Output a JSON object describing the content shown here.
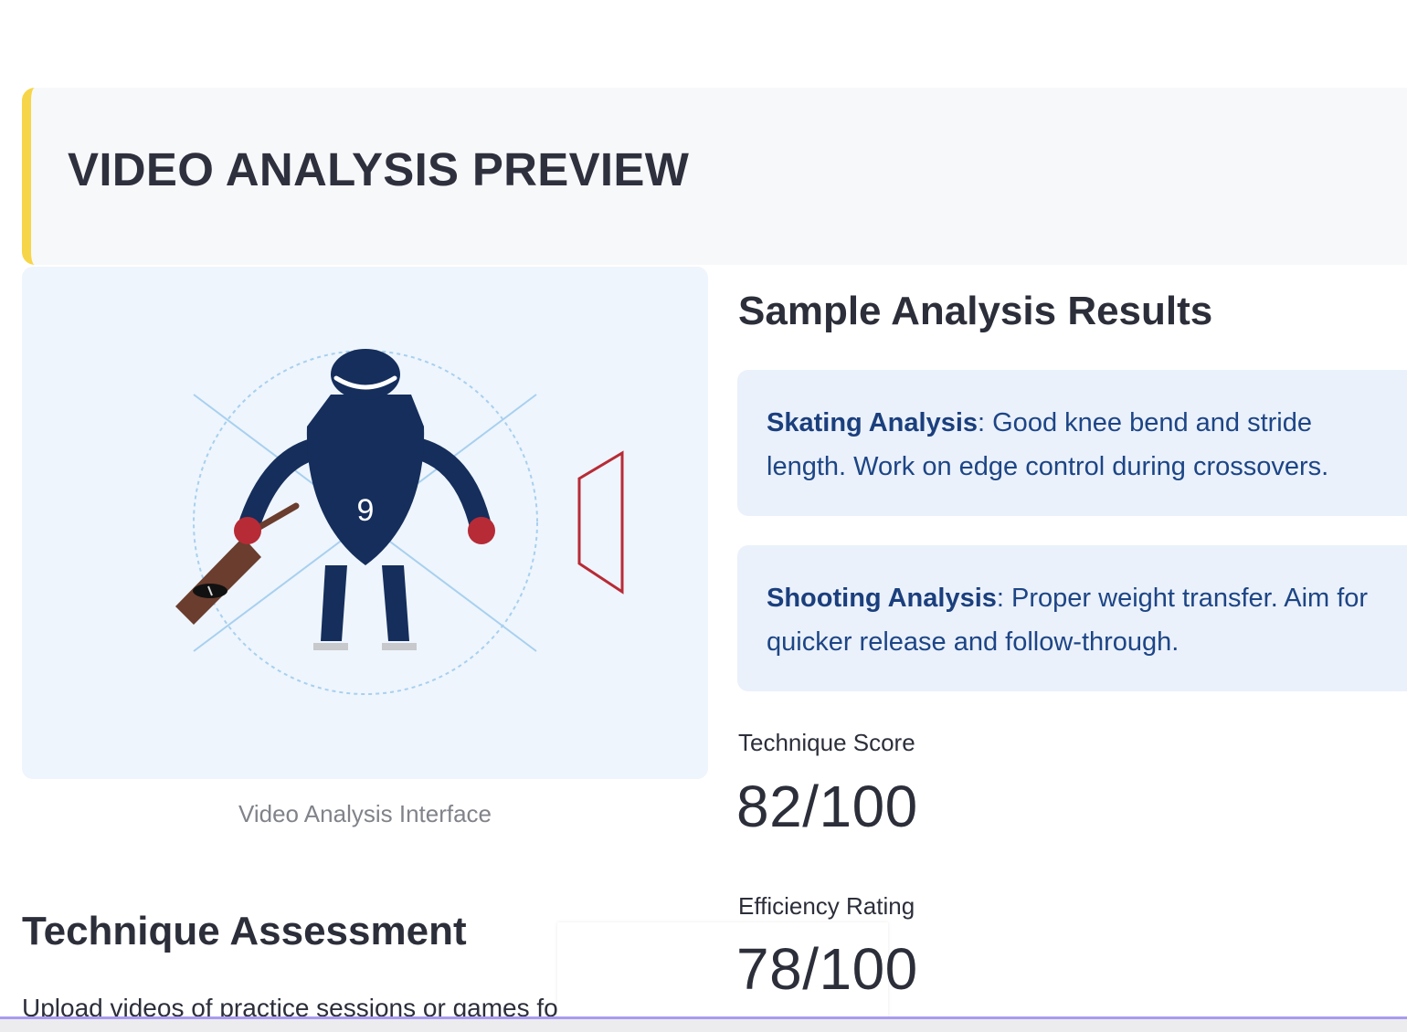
{
  "header": {
    "title": "VIDEO ANALYSIS PREVIEW",
    "accent_color": "#f7d548"
  },
  "video": {
    "caption": "Video Analysis Interface",
    "jersey_number": "9",
    "colors": {
      "player": "#152e5c",
      "gloves": "#b72b36",
      "stick": "#6a3d2e",
      "net": "#b72b36",
      "guides": "#a8d0ef"
    }
  },
  "technique": {
    "title": "Technique Assessment",
    "body": "Upload videos of practice sessions or games for detailed"
  },
  "results": {
    "title": "Sample Analysis Results",
    "cards": [
      {
        "label": "Skating Analysis",
        "text": ": Good knee bend and stride length. Work on edge control during crossovers."
      },
      {
        "label": "Shooting Analysis",
        "text": ": Proper weight transfer. Aim for quicker release and follow-through."
      }
    ],
    "metrics": [
      {
        "label": "Technique Score",
        "value": "82/100"
      },
      {
        "label": "Efficiency Rating",
        "value": "78/100"
      }
    ]
  }
}
